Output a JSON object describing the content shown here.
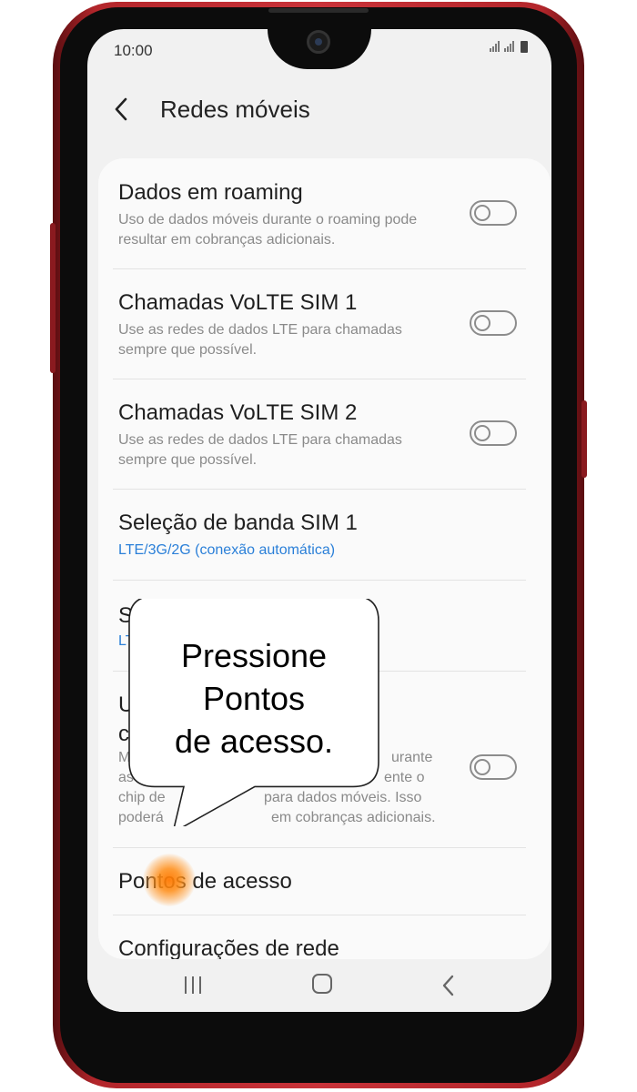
{
  "status_bar": {
    "time": "10:00",
    "signal_icons": "signal-icon",
    "battery_icon": "battery-icon"
  },
  "header": {
    "back_icon": "‹",
    "title": "Redes móveis"
  },
  "settings": [
    {
      "title": "Dados em roaming",
      "description": "Uso de dados móveis durante o roaming pode resultar em cobranças adicionais.",
      "toggle": false
    },
    {
      "title": "Chamadas VoLTE SIM 1",
      "description": "Use as redes de dados LTE para chamadas sempre que possível.",
      "toggle": false
    },
    {
      "title": "Chamadas VoLTE SIM 2",
      "description": "Use as redes de dados LTE para chamadas sempre que possível.",
      "toggle": false
    },
    {
      "title": "Seleção de banda SIM 1",
      "subtitle": "LTE/3G/2G (conexão automática)"
    },
    {
      "title_partial": "Se",
      "subtitle_partial": "LT"
    },
    {
      "title_partial_1": "U",
      "title_partial_2": "c",
      "desc_lines": [
        "M",
        "urante",
        "as",
        "ente o",
        "chip de",
        "para dados móveis. Isso",
        "poderá",
        "em cobranças adicionais."
      ],
      "toggle": false
    },
    {
      "title": "Pontos de acesso",
      "highlighted": true
    },
    {
      "title": "Configurações de rede"
    }
  ],
  "callout": {
    "line1": "Pressione",
    "line2": "Pontos",
    "line3": "de acesso."
  },
  "nav": {
    "recent_icon": "recent-apps-icon",
    "home_icon": "home-icon",
    "back_icon": "‹"
  },
  "colors": {
    "link_blue": "#2a7fd8",
    "tap_orange": "#ff7a00",
    "phone_red": "#c9333a"
  }
}
